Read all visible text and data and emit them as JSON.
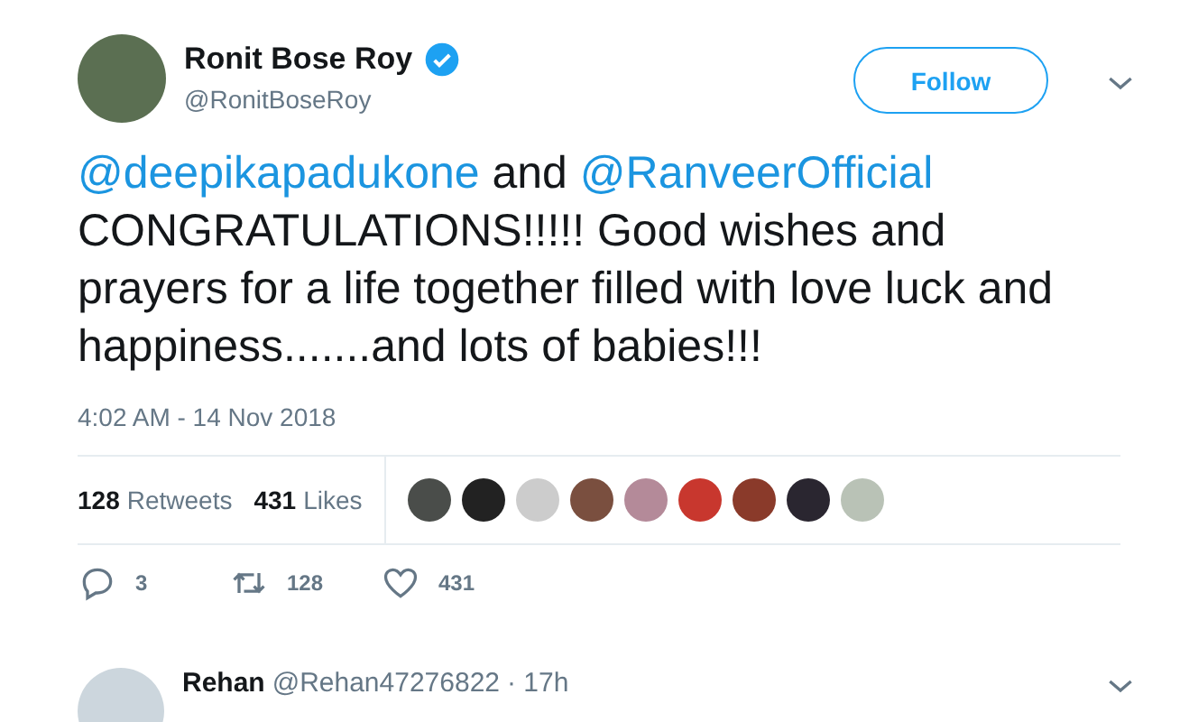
{
  "author": {
    "name": "Ronit Bose Roy",
    "handle": "@RonitBoseRoy",
    "verified": true
  },
  "follow_button": "Follow",
  "tweet_text": [
    {
      "kind": "mention",
      "text": "@deepikapadukone"
    },
    {
      "kind": "text",
      "text": " and "
    },
    {
      "kind": "mention",
      "text": "@RanveerOfficial"
    },
    {
      "kind": "text",
      "text": " CONGRATULATIONS!!!!! Good wishes and prayers for a life together filled with love luck and happiness.......and lots of babies!!!"
    }
  ],
  "timestamp": "4:02 AM - 14 Nov 2018",
  "stats": [
    {
      "count": "128",
      "label": "Retweets"
    },
    {
      "count": "431",
      "label": "Likes"
    }
  ],
  "liker_photos": [
    {
      "kind": "photo"
    },
    {
      "kind": "photo"
    },
    {
      "kind": "photo"
    },
    {
      "kind": "photo"
    },
    {
      "kind": "photo"
    },
    {
      "kind": "photo"
    },
    {
      "kind": "photo"
    },
    {
      "kind": "photo"
    },
    {
      "kind": "photo"
    }
  ],
  "actions": [
    {
      "kind": "reply",
      "count": "3"
    },
    {
      "kind": "retweet",
      "count": "128"
    },
    {
      "kind": "like",
      "count": "431"
    }
  ],
  "reply": {
    "name": "Rehan",
    "handle": "@Rehan47276822",
    "time": "· 17h"
  }
}
